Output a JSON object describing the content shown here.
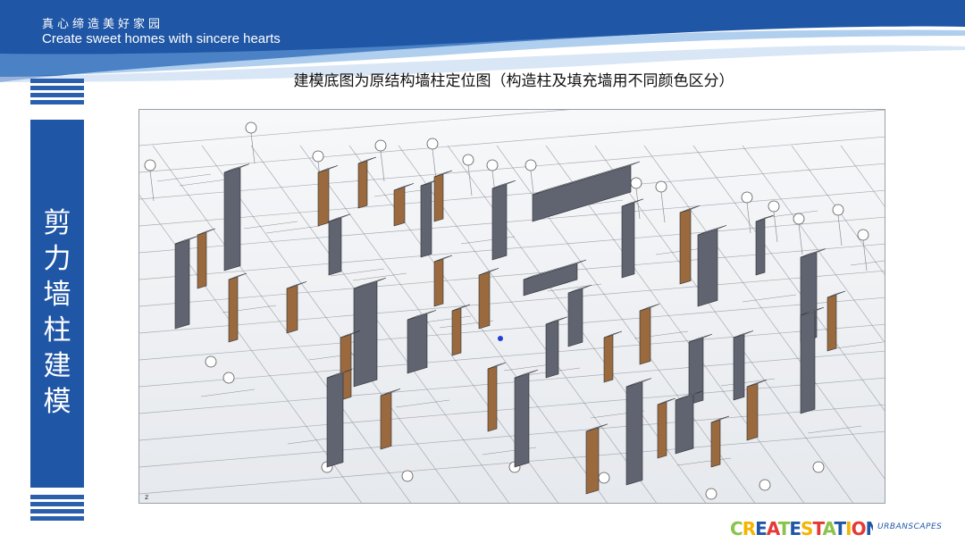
{
  "header": {
    "tagline_cn": "真心缔造美好家园",
    "tagline_en": "Create sweet homes with sincere hearts"
  },
  "slide": {
    "title": "建模底图为原结构墙柱定位图（构造柱及填充墙用不同颜色区分）"
  },
  "sidebar": {
    "chars": [
      "剪",
      "力",
      "墙",
      "柱",
      "建",
      "模"
    ]
  },
  "drawing": {
    "description_icon": "3d-bim-model-image",
    "colors": {
      "shear_wall": "#5f6470",
      "constructional_column": "#9a6a3e",
      "grid_line": "#8b9097"
    }
  },
  "logo": {
    "brand": "CREATESTATIONS",
    "sub": "URBANSCAPES"
  },
  "colors": {
    "brand_blue": "#1f56a6"
  }
}
